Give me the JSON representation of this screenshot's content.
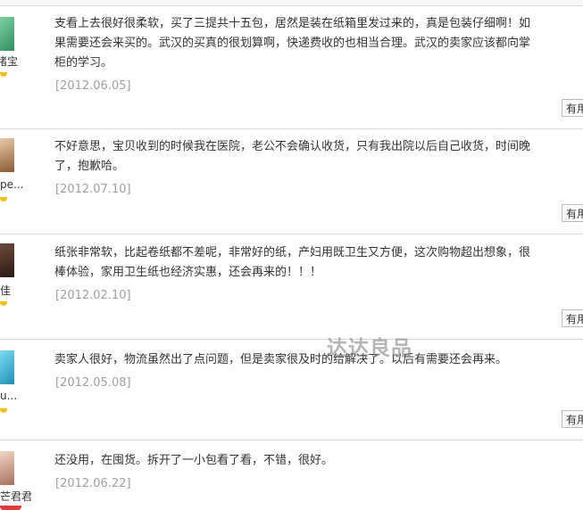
{
  "reviews": [
    {
      "username": "猪宝",
      "content": "支看上去很好很柔软，买了三提共十五包，居然是装在纸箱里发过来的，真是包装仔细啊！如果需要还会来买的。武汉的买真的很划算啊，快递费收的也相当合理。武汉的卖家应该都向掌柜的学习。",
      "content_lines": [
        "支看上去很好很柔软，买了三提共十五包，居然是装在纸箱里发过来的，真是包装仔细啊！如",
        "果需要还会来买的。武汉的买真的很划算啊，快递费收的也相当合理。武汉的卖家应该都向掌",
        "柜的学习。"
      ],
      "date": "[2012.06.05]",
      "useful_label": "有用",
      "avatar_color": "#3aa37a"
    },
    {
      "username": "pe...",
      "content_lines": [
        "不好意思，宝贝收到的时候我在医院，老公不会确认收货，只有我出院以后自己收货，时间晚",
        "了，抱歉哈。"
      ],
      "date": "[2012.07.10]",
      "useful_label": "有用",
      "avatar_color": "#b07a4e"
    },
    {
      "username": "佳",
      "content_lines": [
        "纸张非常软，比起卷纸都不差呢，非常好的纸，产妇用既卫生又方便，这次购物超出想象，很",
        "棒体验，家用卫生纸也经济实惠，还会再来的！！！"
      ],
      "date": "[2012.02.10]",
      "useful_label": "有用",
      "avatar_color": "#4a3328"
    },
    {
      "username": "u...",
      "content_lines": [
        "卖家人很好，物流虽然出了点问题，但是卖家很及时的给解决了。以后有需要还会再来。"
      ],
      "date": "[2012.05.08]",
      "useful_label": "有用",
      "avatar_color": "#2fa4c6"
    },
    {
      "username": "芒君君",
      "content_lines": [
        "还没用，在囤货。拆开了一小包看了看，不错，很好。"
      ],
      "date": "[2012.06.22]",
      "useful_label": "",
      "avatar_color": "#c89a86"
    }
  ],
  "watermark": "达达良品",
  "colors": {
    "date": "#a0a0a0",
    "divider": "#d9d9d9",
    "badge": "#f2c200"
  },
  "icons": {
    "badge": "gold-heart-icon"
  }
}
